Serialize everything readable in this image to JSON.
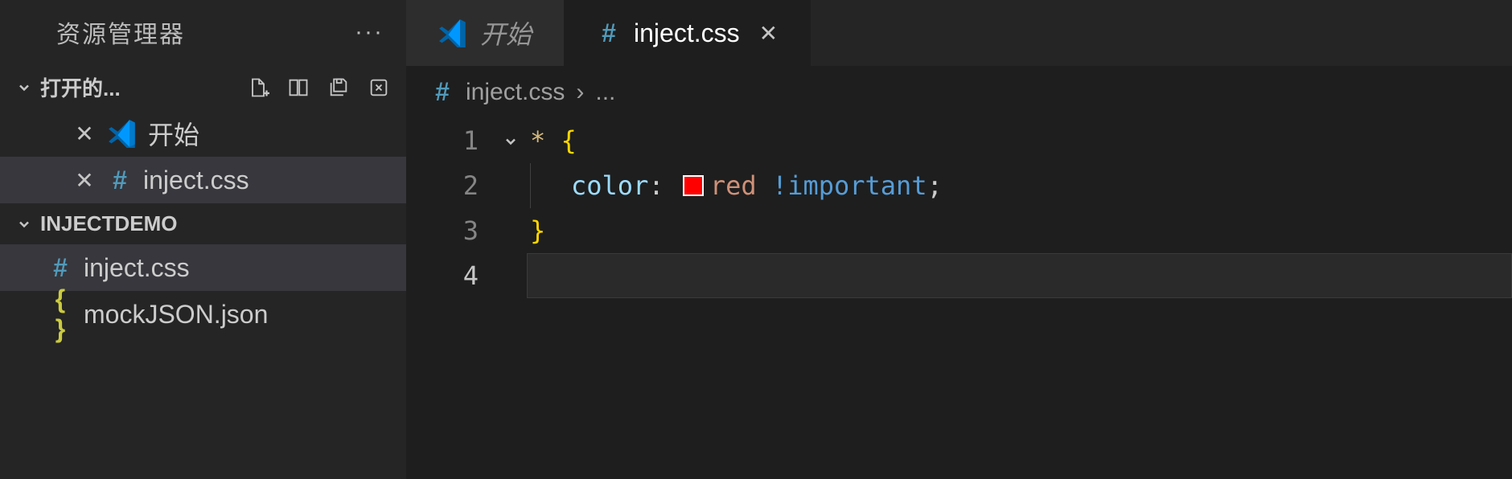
{
  "sidebar": {
    "title": "资源管理器",
    "openEditors": {
      "header": "打开的...",
      "items": [
        {
          "label": "开始",
          "icon": "vscode"
        },
        {
          "label": "inject.css",
          "icon": "hash"
        }
      ]
    },
    "folder": {
      "name": "INJECTDEMO",
      "files": [
        {
          "label": "inject.css",
          "icon": "hash",
          "selected": true
        },
        {
          "label": "mockJSON.json",
          "icon": "json",
          "selected": false
        }
      ]
    }
  },
  "tabs": [
    {
      "label": "开始",
      "icon": "vscode",
      "active": false
    },
    {
      "label": "inject.css",
      "icon": "hash",
      "active": true
    }
  ],
  "breadcrumb": {
    "file": "inject.css",
    "rest": "..."
  },
  "code": {
    "line1": {
      "selector": "*",
      "brace": "{"
    },
    "line2": {
      "prop": "color",
      "colon": ":",
      "swatch": "#ff0000",
      "value": "red",
      "important": "!important",
      "semi": ";"
    },
    "line3": {
      "brace": "}"
    },
    "lineNumbers": [
      "1",
      "2",
      "3",
      "4"
    ]
  }
}
